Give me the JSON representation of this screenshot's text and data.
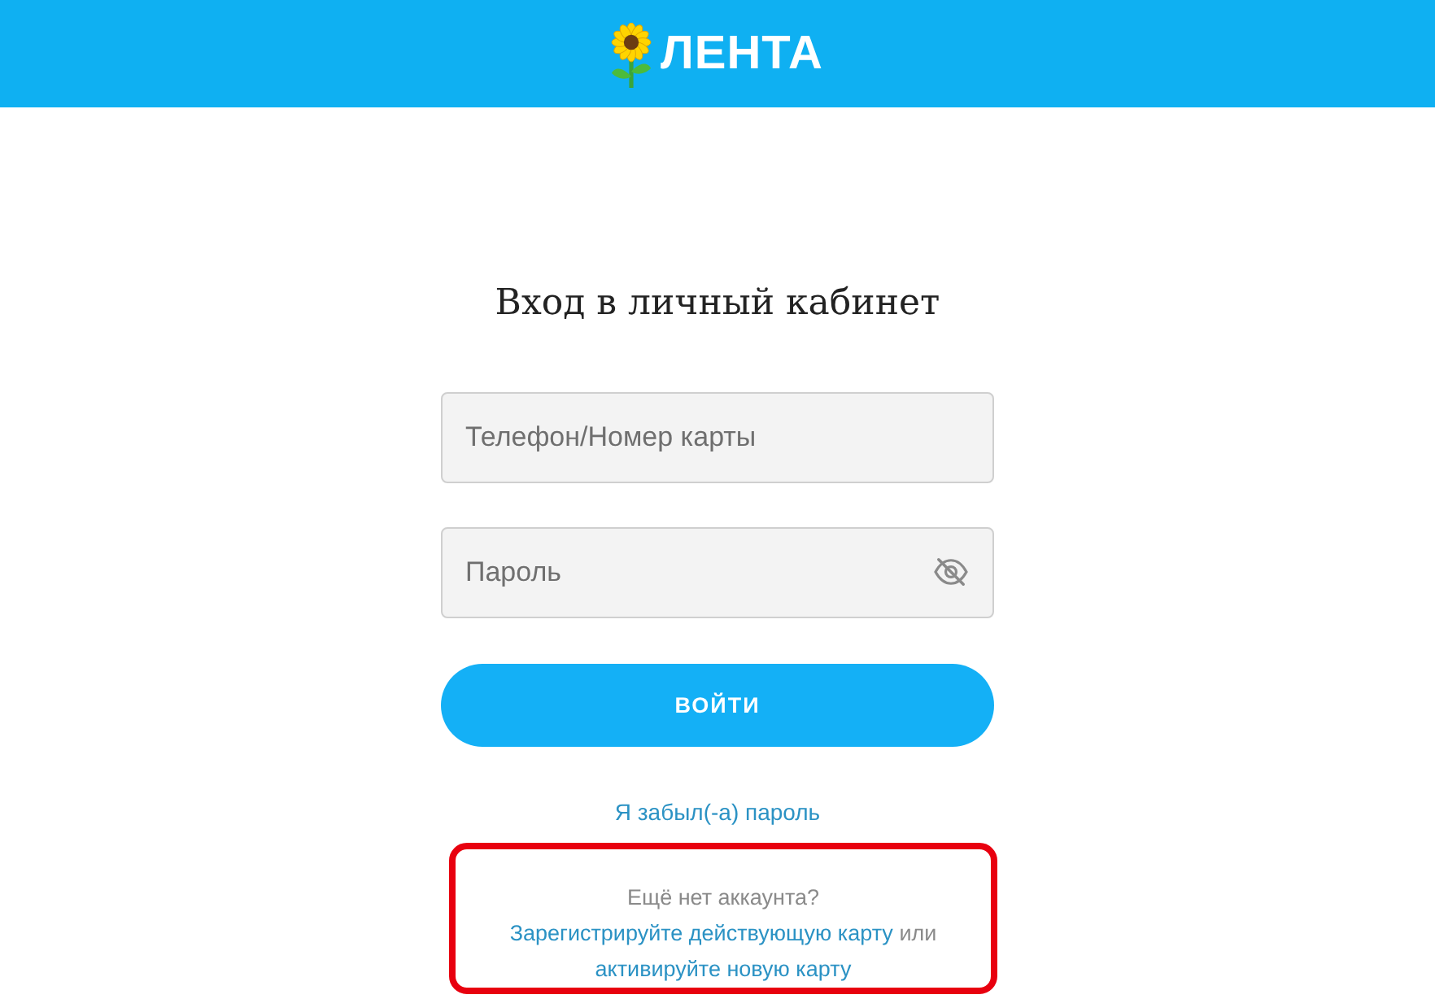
{
  "header": {
    "logo_text": "ЛЕНТА"
  },
  "title": "Вход в личный кабинет",
  "fields": [
    {
      "kind": "text",
      "placeholder": "Телефон/Номер карты"
    },
    {
      "kind": "password",
      "placeholder": "Пароль",
      "password_visible": false
    }
  ],
  "submit_button": "ВОЙТИ",
  "forgot_link": "Я забыл(-а) пароль",
  "register": {
    "highlighted": true,
    "parts": [
      {
        "kind": "text",
        "text": "Ещё нет аккаунта?"
      },
      {
        "kind": "link",
        "text": "Зарегистрируйте действующую карту"
      },
      {
        "kind": "text",
        "text": "или"
      },
      {
        "kind": "link",
        "text": "активируйте новую карту"
      }
    ]
  }
}
